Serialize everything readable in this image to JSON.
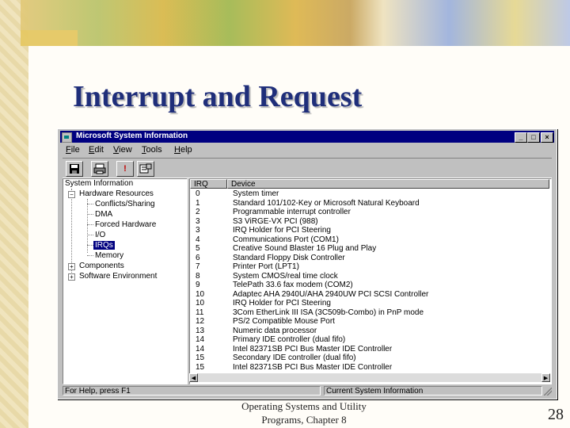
{
  "slide": {
    "title": "Interrupt and Request",
    "footer_line1": "Operating Systems and Utility",
    "footer_line2": "Programs,  Chapter 8",
    "page_number": "28"
  },
  "window": {
    "title": "Microsoft System Information",
    "buttons": {
      "minimize": "_",
      "maximize": "□",
      "close": "×"
    }
  },
  "menu": [
    "File",
    "Edit",
    "View",
    "Tools",
    "Help"
  ],
  "toolbar_icons": [
    "save-icon",
    "print-icon",
    "alert-icon",
    "properties-icon"
  ],
  "toolbar_glyphs": {
    "alert": "!"
  },
  "tree": {
    "root": "System Information",
    "items": [
      {
        "label": "Hardware Resources",
        "expander": "−"
      },
      {
        "label": "Conflicts/Sharing"
      },
      {
        "label": "DMA"
      },
      {
        "label": "Forced Hardware"
      },
      {
        "label": "I/O"
      },
      {
        "label": "IRQs",
        "selected": true
      },
      {
        "label": "Memory"
      },
      {
        "label": "Components",
        "expander": "+"
      },
      {
        "label": "Software Environment",
        "expander": "+"
      }
    ]
  },
  "list": {
    "columns": [
      "IRQ",
      "Device"
    ],
    "rows": [
      [
        "0",
        "System timer"
      ],
      [
        "1",
        "Standard 101/102-Key or Microsoft Natural Keyboard"
      ],
      [
        "2",
        "Programmable interrupt controller"
      ],
      [
        "3",
        "S3 ViRGE-VX PCI (988)"
      ],
      [
        "3",
        "IRQ Holder for PCI Steering"
      ],
      [
        "4",
        "Communications Port (COM1)"
      ],
      [
        "5",
        "Creative Sound Blaster 16 Plug and Play"
      ],
      [
        "6",
        "Standard Floppy Disk Controller"
      ],
      [
        "7",
        "Printer Port (LPT1)"
      ],
      [
        "8",
        "System CMOS/real time clock"
      ],
      [
        "9",
        "TelePath 33.6 fax modem (COM2)"
      ],
      [
        "10",
        "Adaptec AHA 2940U/AHA 2940UW PCI SCSI Controller"
      ],
      [
        "10",
        "IRQ Holder for PCI Steering"
      ],
      [
        "11",
        "3Com EtherLink III ISA (3C509b-Combo) in PnP mode"
      ],
      [
        "12",
        "PS/2 Compatible Mouse Port"
      ],
      [
        "13",
        "Numeric data processor"
      ],
      [
        "14",
        "Primary IDE controller (dual fifo)"
      ],
      [
        "14",
        "Intel 82371SB PCI Bus Master IDE Controller"
      ],
      [
        "15",
        "Secondary IDE controller (dual fifo)"
      ],
      [
        "15",
        "Intel 82371SB PCI Bus Master IDE Controller"
      ]
    ]
  },
  "status": {
    "help": "For Help, press F1",
    "context": "Current System Information"
  }
}
